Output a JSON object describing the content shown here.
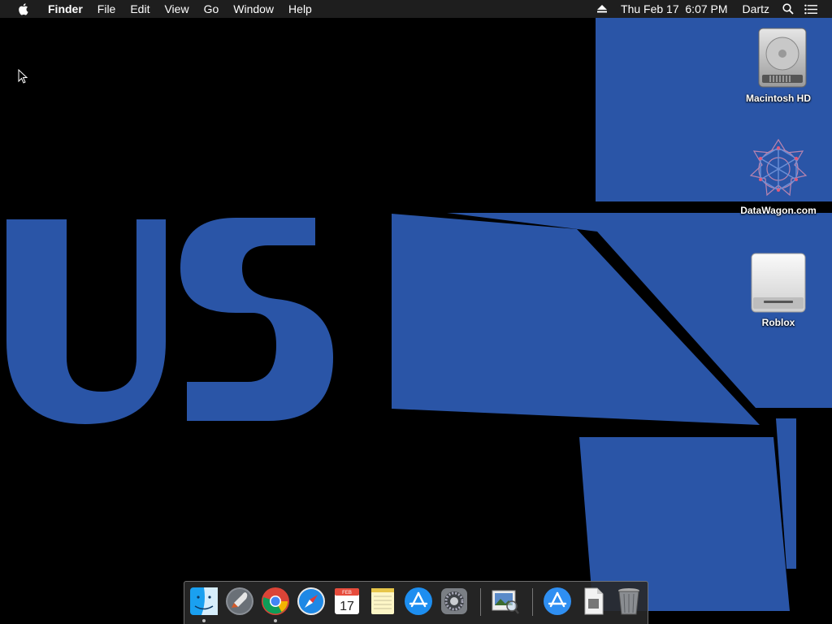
{
  "menubar": {
    "app_name": "Finder",
    "menus": [
      "File",
      "Edit",
      "View",
      "Go",
      "Window",
      "Help"
    ],
    "datetime": "Thu Feb 17  6:07 PM",
    "user": "Dartz",
    "icons": [
      "apple-icon",
      "eject-icon",
      "spotlight-search-icon",
      "notification-center-icon"
    ]
  },
  "desktop": {
    "wallpaper_colors": {
      "background": "#000000",
      "accent": "#2a55a7"
    },
    "wallpaper_text": "US",
    "icons": [
      {
        "label": "Macintosh HD",
        "icon": "hard-drive-icon"
      },
      {
        "label": "DataWagon.com",
        "icon": "network-volume-icon"
      },
      {
        "label": "Roblox",
        "icon": "disk-image-icon"
      }
    ]
  },
  "dock": {
    "items": [
      {
        "name": "Finder",
        "icon": "finder-icon",
        "running": true
      },
      {
        "name": "Launchpad",
        "icon": "launchpad-icon",
        "running": false
      },
      {
        "name": "Google Chrome",
        "icon": "chrome-icon",
        "running": true
      },
      {
        "name": "Safari",
        "icon": "safari-icon",
        "running": false
      },
      {
        "name": "Calendar",
        "icon": "calendar-icon",
        "running": false,
        "month": "FEB",
        "day": "17"
      },
      {
        "name": "Notes",
        "icon": "notes-icon",
        "running": false
      },
      {
        "name": "App Store",
        "icon": "app-store-icon",
        "running": false
      },
      {
        "name": "System Preferences",
        "icon": "system-preferences-icon",
        "running": false
      },
      {
        "name": "Preview",
        "icon": "preview-icon",
        "running": false
      },
      {
        "name": "Applications",
        "icon": "applications-folder-icon",
        "running": false
      },
      {
        "name": "Documents",
        "icon": "documents-stack-icon",
        "running": false
      },
      {
        "name": "Trash",
        "icon": "trash-icon",
        "running": false
      }
    ]
  }
}
